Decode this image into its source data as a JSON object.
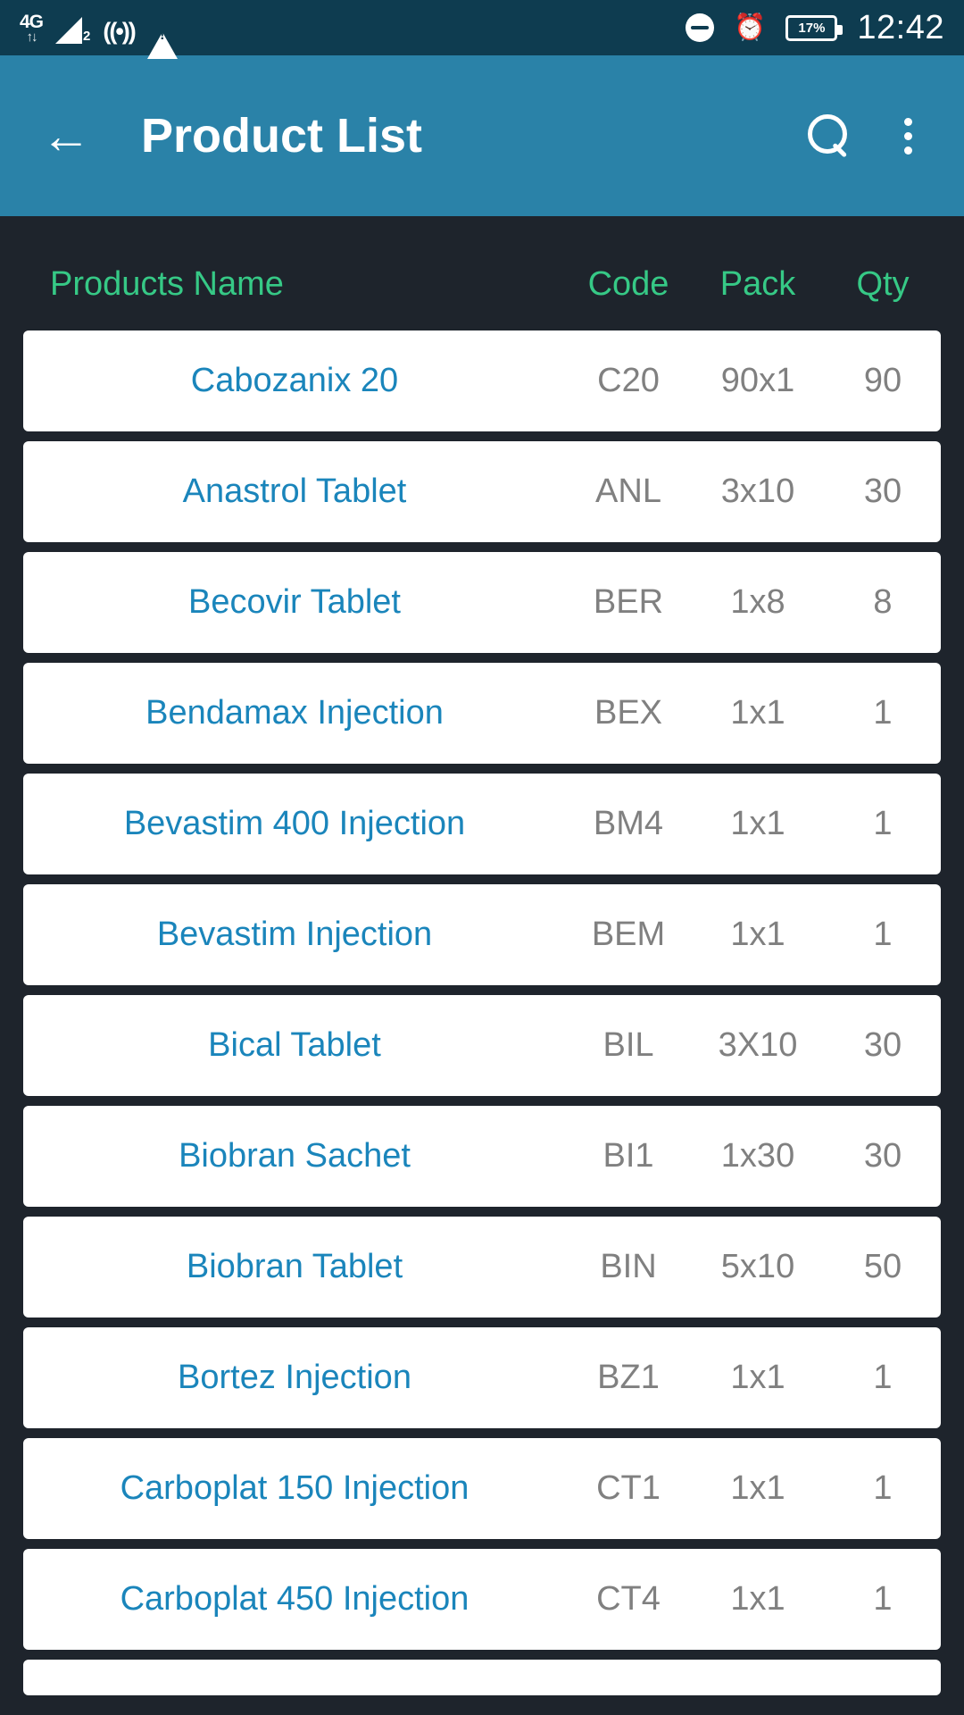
{
  "status_bar": {
    "network_type": "4G",
    "data_arrows": "↑↓",
    "signal_sim": "2",
    "hotspot_icon": "hotspot-icon",
    "warning_icon": "warning-icon",
    "warning_glyph": "!",
    "dnd_icon": "do-not-disturb-icon",
    "alarm_icon": "⏰",
    "battery_percent": "17%",
    "clock": "12:42"
  },
  "app_bar": {
    "back_icon": "←",
    "title": "Product List",
    "search_icon": "search-icon",
    "overflow_icon": "overflow-menu-icon"
  },
  "colors": {
    "status_bar_bg": "#0e3c50",
    "app_bar_bg": "#2a82a8",
    "page_bg": "#1e242c",
    "header_text": "#36c986",
    "row_bg": "#ffffff",
    "product_name": "#1a85bb",
    "row_value": "#808080"
  },
  "table": {
    "headers": {
      "name": "Products Name",
      "code": "Code",
      "pack": "Pack",
      "qty": "Qty"
    },
    "rows": [
      {
        "name": "Cabozanix 20",
        "code": "C20",
        "pack": "90x1",
        "qty": "90"
      },
      {
        "name": "Anastrol Tablet",
        "code": "ANL",
        "pack": "3x10",
        "qty": "30"
      },
      {
        "name": "Becovir Tablet",
        "code": "BER",
        "pack": "1x8",
        "qty": "8"
      },
      {
        "name": "Bendamax Injection",
        "code": "BEX",
        "pack": "1x1",
        "qty": "1"
      },
      {
        "name": "Bevastim 400 Injection",
        "code": "BM4",
        "pack": "1x1",
        "qty": "1"
      },
      {
        "name": "Bevastim Injection",
        "code": "BEM",
        "pack": "1x1",
        "qty": "1"
      },
      {
        "name": "Bical Tablet",
        "code": "BIL",
        "pack": "3X10",
        "qty": "30"
      },
      {
        "name": "Biobran Sachet",
        "code": "BI1",
        "pack": "1x30",
        "qty": "30"
      },
      {
        "name": "Biobran Tablet",
        "code": "BIN",
        "pack": "5x10",
        "qty": "50"
      },
      {
        "name": "Bortez Injection",
        "code": "BZ1",
        "pack": "1x1",
        "qty": "1"
      },
      {
        "name": "Carboplat 150 Injection",
        "code": "CT1",
        "pack": "1x1",
        "qty": "1"
      },
      {
        "name": "Carboplat 450 Injection",
        "code": "CT4",
        "pack": "1x1",
        "qty": "1"
      }
    ]
  }
}
